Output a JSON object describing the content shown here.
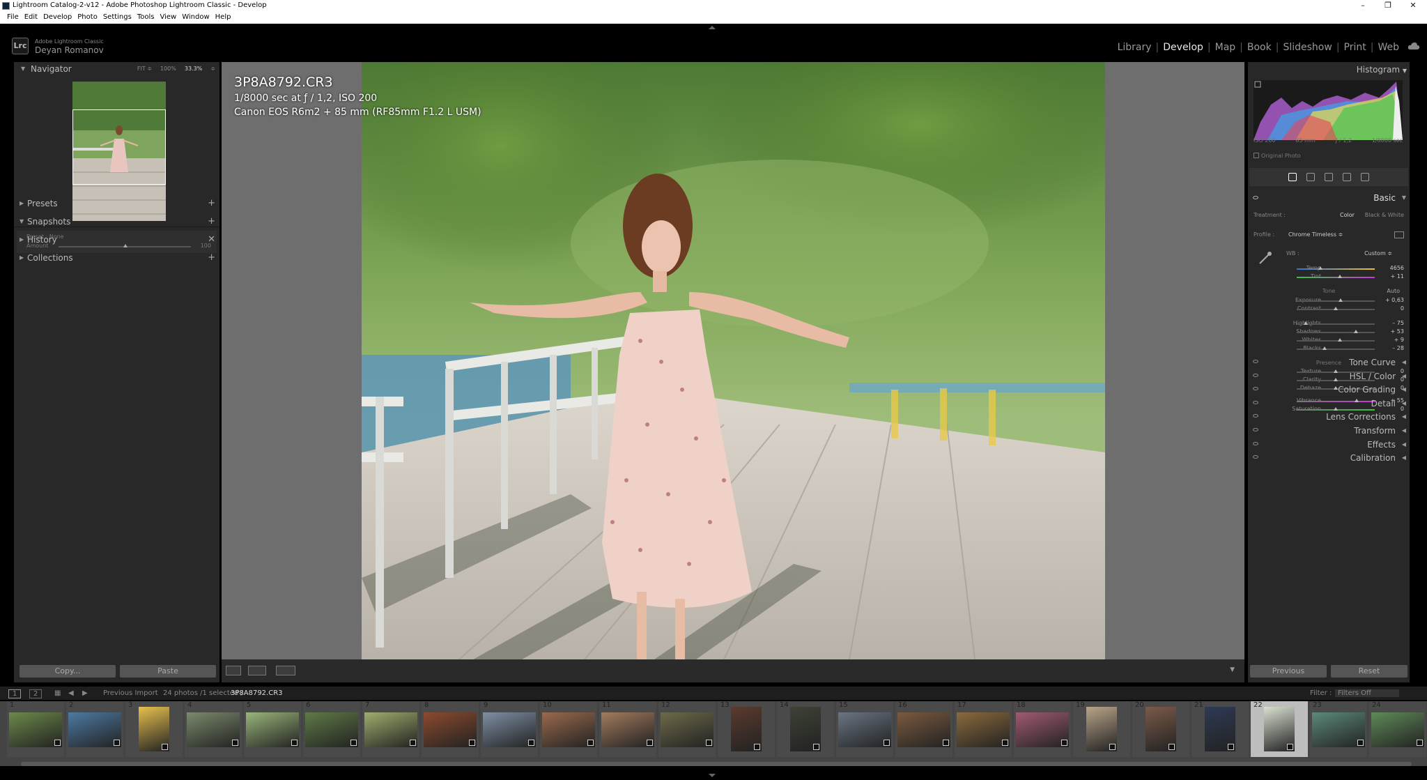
{
  "window": {
    "title": "Lightroom Catalog-2-v12 - Adobe Photoshop Lightroom Classic - Develop",
    "min": "–",
    "max": "❐",
    "close": "✕"
  },
  "menu": [
    "File",
    "Edit",
    "Develop",
    "Photo",
    "Settings",
    "Tools",
    "View",
    "Window",
    "Help"
  ],
  "identity": {
    "logo": "Lrc",
    "product": "Adobe Lightroom Classic",
    "user": "Deyan Romanov"
  },
  "modules": [
    {
      "label": "Library",
      "active": false
    },
    {
      "label": "Develop",
      "active": true
    },
    {
      "label": "Map",
      "active": false
    },
    {
      "label": "Book",
      "active": false
    },
    {
      "label": "Slideshow",
      "active": false
    },
    {
      "label": "Print",
      "active": false
    },
    {
      "label": "Web",
      "active": false
    }
  ],
  "left": {
    "navigator": {
      "title": "Navigator",
      "fit": "FIT ≑",
      "p100": "100%",
      "zoom": "33.3%",
      "zoom_arrow": "≑"
    },
    "preset": {
      "label": "Preset : None",
      "amount": "Amount",
      "amount_value": "100"
    },
    "sections": [
      {
        "label": "Presets",
        "action": "+"
      },
      {
        "label": "Snapshots",
        "action": "+"
      },
      {
        "label": "History",
        "action": "✕"
      },
      {
        "label": "Collections",
        "action": "+"
      }
    ],
    "copy": "Copy...",
    "paste": "Paste"
  },
  "photo": {
    "filename": "3P8A8792.CR3",
    "exposure_line": "1/8000 sec at ƒ / 1,2, ISO 200",
    "camera_line": "Canon EOS R6m2 + 85 mm (RF85mm F1.2 L USM)"
  },
  "right": {
    "histogram_title": "Histogram",
    "histo_meta": [
      "ISO 200",
      "85 mm",
      "ƒ / 1,2",
      "1/8000 sec"
    ],
    "original_photo": "Original Photo",
    "basic_title": "Basic",
    "treatment_label": "Treatment :",
    "treatment_color": "Color",
    "treatment_bw": "Black & White",
    "profile_label": "Profile :",
    "profile_value": "Chrome Timeless ≑",
    "wb_label": "WB :",
    "wb_value": "Custom ≑",
    "temp": {
      "label": "Temp",
      "value": "4656",
      "pos": 0.3
    },
    "tint": {
      "label": "Tint",
      "value": "+ 11",
      "pos": 0.55
    },
    "tone_title": "Tone",
    "auto": "Auto",
    "tone": [
      {
        "label": "Exposure",
        "value": "+ 0,63",
        "pos": 0.56
      },
      {
        "label": "Contrast",
        "value": "0",
        "pos": 0.5
      },
      {
        "label": "Highlights",
        "value": "– 75",
        "pos": 0.12
      },
      {
        "label": "Shadows",
        "value": "+ 53",
        "pos": 0.76
      },
      {
        "label": "Whites",
        "value": "+ 9",
        "pos": 0.55
      },
      {
        "label": "Blacks",
        "value": "– 28",
        "pos": 0.36
      }
    ],
    "presence_title": "Presence",
    "presence": [
      {
        "label": "Texture",
        "value": "0",
        "pos": 0.5
      },
      {
        "label": "Clarity",
        "value": "0",
        "pos": 0.5
      },
      {
        "label": "Dehaze",
        "value": "0",
        "pos": 0.5
      },
      {
        "label": "Vibrance",
        "value": "+ 55",
        "pos": 0.77
      },
      {
        "label": "Saturation",
        "value": "0",
        "pos": 0.5
      }
    ],
    "collapsed": [
      "Tone Curve",
      "HSL / Color",
      "Color Grading",
      "Detail",
      "Lens Corrections",
      "Transform",
      "Effects",
      "Calibration"
    ],
    "previous": "Previous",
    "reset": "Reset"
  },
  "filmbar": {
    "screen1": "1",
    "screen2": "2",
    "source": "Previous Import",
    "count": "24 photos /1 selected /",
    "selected_file": "3P8A8792.CR3",
    "filter_label": "Filter :",
    "filter_value": "Filters Off"
  },
  "filmstrip": {
    "cells": [
      {
        "n": "1",
        "c": "#6c8a4a"
      },
      {
        "n": "2",
        "c": "#4d7aa3"
      },
      {
        "n": "3",
        "c": "#e7c04e"
      },
      {
        "n": "4",
        "c": "#7b8a6c"
      },
      {
        "n": "5",
        "c": "#9ab57a"
      },
      {
        "n": "6",
        "c": "#5f7a47"
      },
      {
        "n": "7",
        "c": "#9fae6d"
      },
      {
        "n": "8",
        "c": "#8c4a2e"
      },
      {
        "n": "9",
        "c": "#7f8fa5"
      },
      {
        "n": "10",
        "c": "#9a6a4d"
      },
      {
        "n": "11",
        "c": "#a27b5e"
      },
      {
        "n": "12",
        "c": "#6d6a4a"
      },
      {
        "n": "13",
        "c": "#5a3b2e"
      },
      {
        "n": "14",
        "c": "#3e4236"
      },
      {
        "n": "15",
        "c": "#6a7584"
      },
      {
        "n": "16",
        "c": "#7a5a3e"
      },
      {
        "n": "17",
        "c": "#8b6a3c"
      },
      {
        "n": "18",
        "c": "#a05a72"
      },
      {
        "n": "19",
        "c": "#b9a48a"
      },
      {
        "n": "20",
        "c": "#7b5a4a"
      },
      {
        "n": "21",
        "c": "#2e3a55"
      },
      {
        "n": "22",
        "c": "#d9e0d0"
      },
      {
        "n": "23",
        "c": "#5c8a7a"
      },
      {
        "n": "24",
        "c": "#5f8a58"
      }
    ]
  }
}
